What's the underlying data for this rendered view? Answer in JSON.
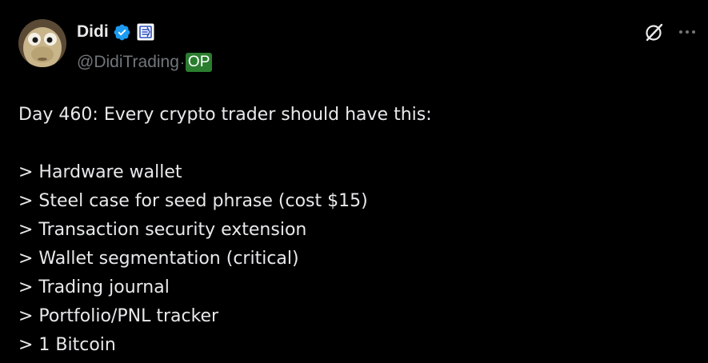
{
  "author": {
    "display_name": "Didi",
    "handle": "@DidiTrading",
    "separator": "·",
    "op_badge": "OP",
    "verified_color": "#1d9bf0",
    "affiliate_icon": "affiliate-badge-icon"
  },
  "actions": {
    "grok_icon": "grok-icon",
    "more_icon": "more-options-icon"
  },
  "tweet": {
    "headline": "Day 460: Every crypto trader should have this:",
    "items": [
      "> Hardware wallet",
      "> Steel case for seed phrase (cost $15)",
      "> Transaction security extension",
      "> Wallet segmentation (critical)",
      "> Trading journal",
      "> Portfolio/PNL tracker",
      "> 1 Bitcoin"
    ]
  },
  "colors": {
    "background": "#000000",
    "text_primary": "#e7e9ea",
    "text_secondary": "#71767b",
    "op_badge_bg": "#2a7d2e"
  }
}
